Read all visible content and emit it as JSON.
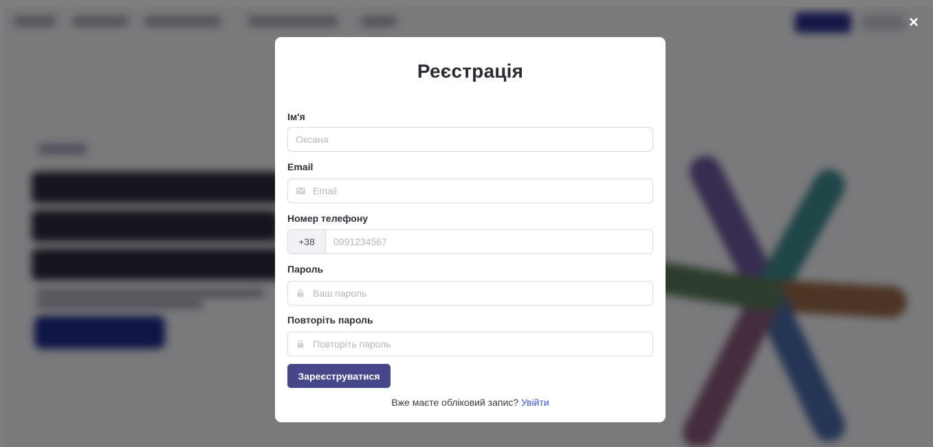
{
  "modal": {
    "title": "Реєстрація",
    "fields": {
      "name": {
        "label": "Ім'я",
        "placeholder": "Оксана"
      },
      "email": {
        "label": "Email",
        "placeholder": "Email",
        "icon": "envelope-icon"
      },
      "phone": {
        "label": "Номер телефону",
        "prefix": "+38",
        "placeholder": "0991234567"
      },
      "password": {
        "label": "Пароль",
        "placeholder": "Ваш пароль",
        "icon": "lock-icon"
      },
      "password_repeat": {
        "label": "Повторіть пароль",
        "placeholder": "Повторіть пароль",
        "icon": "lock-icon"
      }
    },
    "submit_label": "Зареєструватися",
    "login_prompt": "Вже маєте обліковий запис?",
    "login_link": "Увійти"
  },
  "close_label": "×",
  "colors": {
    "overlay": "rgba(0,0,0,0.5)",
    "primary_button": "#46468a",
    "link": "#3b4fd8",
    "title_text": "#2b2b33"
  }
}
